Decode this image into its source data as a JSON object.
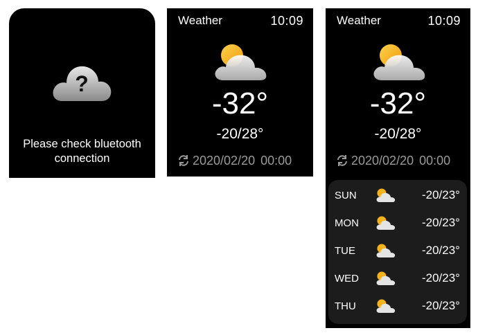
{
  "error_screen": {
    "message": "Please check bluetooth connection",
    "icon": "cloud-question-icon"
  },
  "weather_screen": {
    "title": "Weather",
    "time": "10:09",
    "icon": "partly-cloudy-icon",
    "temperature": "-32°",
    "range": "-20/28°",
    "sync_icon": "refresh-icon",
    "sync_date": "2020/02/20",
    "sync_time": "00:00"
  },
  "forecast_screen": {
    "title": "Weather",
    "time": "10:09",
    "icon": "partly-cloudy-icon",
    "temperature": "-32°",
    "range": "-20/28°",
    "sync_icon": "refresh-icon",
    "sync_date": "2020/02/20",
    "sync_time": "00:00",
    "days": [
      {
        "day": "SUN",
        "icon": "partly-cloudy-icon",
        "range": "-20/23°"
      },
      {
        "day": "MON",
        "icon": "partly-cloudy-icon",
        "range": "-20/23°"
      },
      {
        "day": "TUE",
        "icon": "partly-cloudy-icon",
        "range": "-20/23°"
      },
      {
        "day": "WED",
        "icon": "partly-cloudy-icon",
        "range": "-20/23°"
      },
      {
        "day": "THU",
        "icon": "partly-cloudy-icon",
        "range": "-20/23°"
      }
    ]
  },
  "colors": {
    "screen_bg": "#000000",
    "panel_bg": "#1c1c1c",
    "text_primary": "#ffffff",
    "text_muted": "#9a9a9a",
    "sun": "#f6b21b",
    "cloud": "#e6e6e6"
  }
}
